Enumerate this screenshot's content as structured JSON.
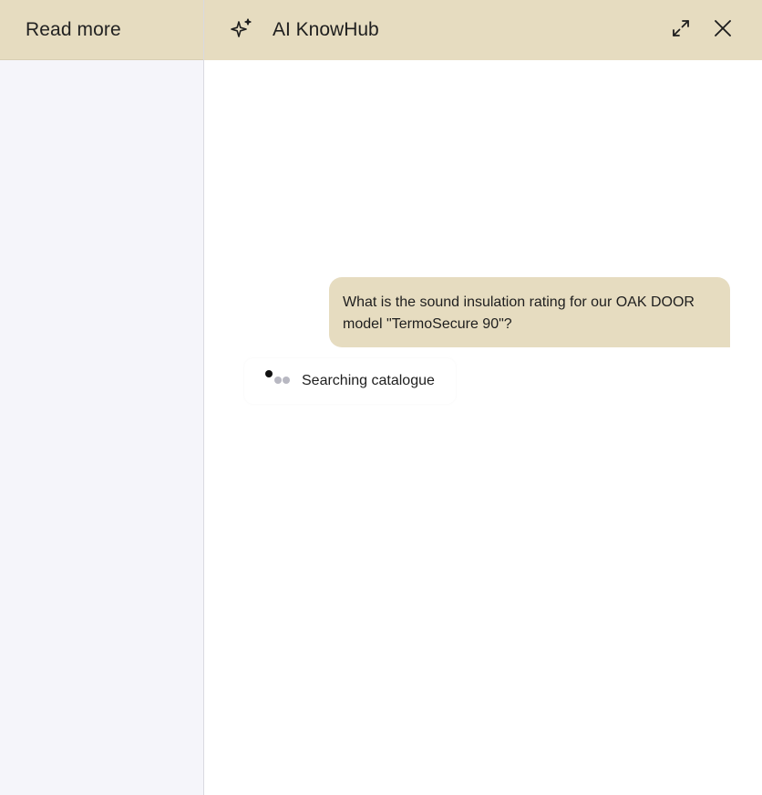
{
  "sidepanel": {
    "title": "Read more"
  },
  "chat": {
    "title": "AI KnowHub",
    "icons": {
      "logo": "sparkle-icon",
      "expand": "expand-icon",
      "close": "close-icon"
    },
    "messages": [
      {
        "role": "user",
        "text": "What is the sound insulation rating for our OAK DOOR model \"TermoSecure 90\"?"
      }
    ],
    "status": {
      "text": "Searching catalogue"
    }
  },
  "colors": {
    "header_bg": "#e6dcc0",
    "sidepanel_bg": "#f5f5fa",
    "user_bubble_bg": "#e6dcc0"
  }
}
